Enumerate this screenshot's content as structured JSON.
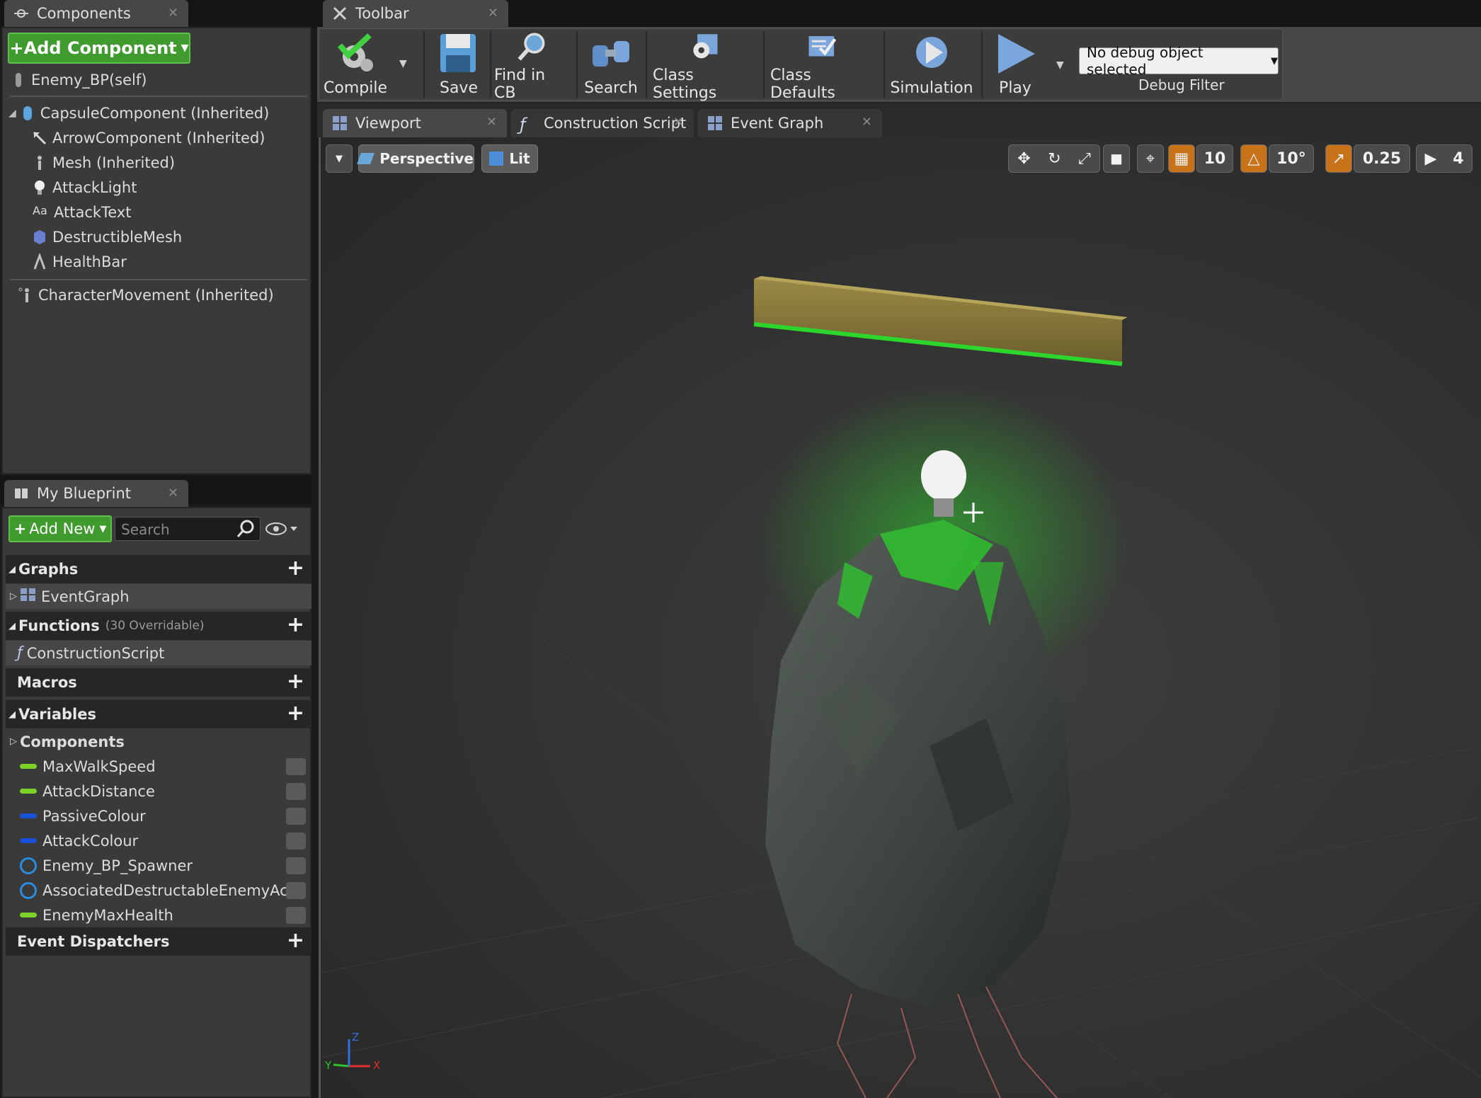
{
  "components_panel": {
    "tab_label": "Components",
    "add_button": "+Add Component",
    "self_item": "Enemy_BP(self)",
    "tree": [
      "CapsuleComponent (Inherited)",
      "ArrowComponent (Inherited)",
      "Mesh (Inherited)",
      "AttackLight",
      "AttackText",
      "DestructibleMesh",
      "HealthBar"
    ],
    "movement_item": "CharacterMovement (Inherited)"
  },
  "blueprint_panel": {
    "tab_label": "My Blueprint",
    "add_new": "Add New",
    "search_placeholder": "Search",
    "graphs_label": "Graphs",
    "event_graph_item": "EventGraph",
    "functions_label": "Functions",
    "functions_note": "(30 Overridable)",
    "construction_item": "ConstructionScript",
    "macros_label": "Macros",
    "variables_label": "Variables",
    "components_label": "Components",
    "variables": [
      {
        "name": "MaxWalkSpeed",
        "kind": "pill",
        "color": "#7cd12a"
      },
      {
        "name": "AttackDistance",
        "kind": "pill",
        "color": "#7cd12a"
      },
      {
        "name": "PassiveColour",
        "kind": "pill",
        "color": "#1b4fd6"
      },
      {
        "name": "AttackColour",
        "kind": "pill",
        "color": "#1b4fd6"
      },
      {
        "name": "Enemy_BP_Spawner",
        "kind": "ring",
        "color": "#2a8ee0"
      },
      {
        "name": "AssociatedDestructableEnemyAc",
        "kind": "ring",
        "color": "#2a8ee0"
      },
      {
        "name": "EnemyMaxHealth",
        "kind": "pill",
        "color": "#7cd12a"
      }
    ],
    "dispatchers_label": "Event Dispatchers"
  },
  "toolbar": {
    "tab_label": "Toolbar",
    "compile": "Compile",
    "save": "Save",
    "find_in_cb": "Find in CB",
    "search": "Search",
    "class_settings": "Class Settings",
    "class_defaults": "Class Defaults",
    "simulation": "Simulation",
    "play": "Play",
    "debug_select": "No debug object selected",
    "debug_filter": "Debug Filter"
  },
  "editor_tabs": {
    "viewport": "Viewport",
    "construction_script": "Construction Script",
    "event_graph": "Event Graph"
  },
  "viewport": {
    "perspective": "Perspective",
    "lit": "Lit",
    "grid_snap": "10",
    "rotation_snap": "10°",
    "scale_snap": "0.25",
    "camera_speed": "4",
    "axis_x": "X",
    "axis_y": "Y",
    "axis_z": "Z"
  },
  "colors": {
    "accent_green": "#3f9b2e",
    "snap_orange": "#c8731a",
    "glow_green": "#2cd62c"
  }
}
